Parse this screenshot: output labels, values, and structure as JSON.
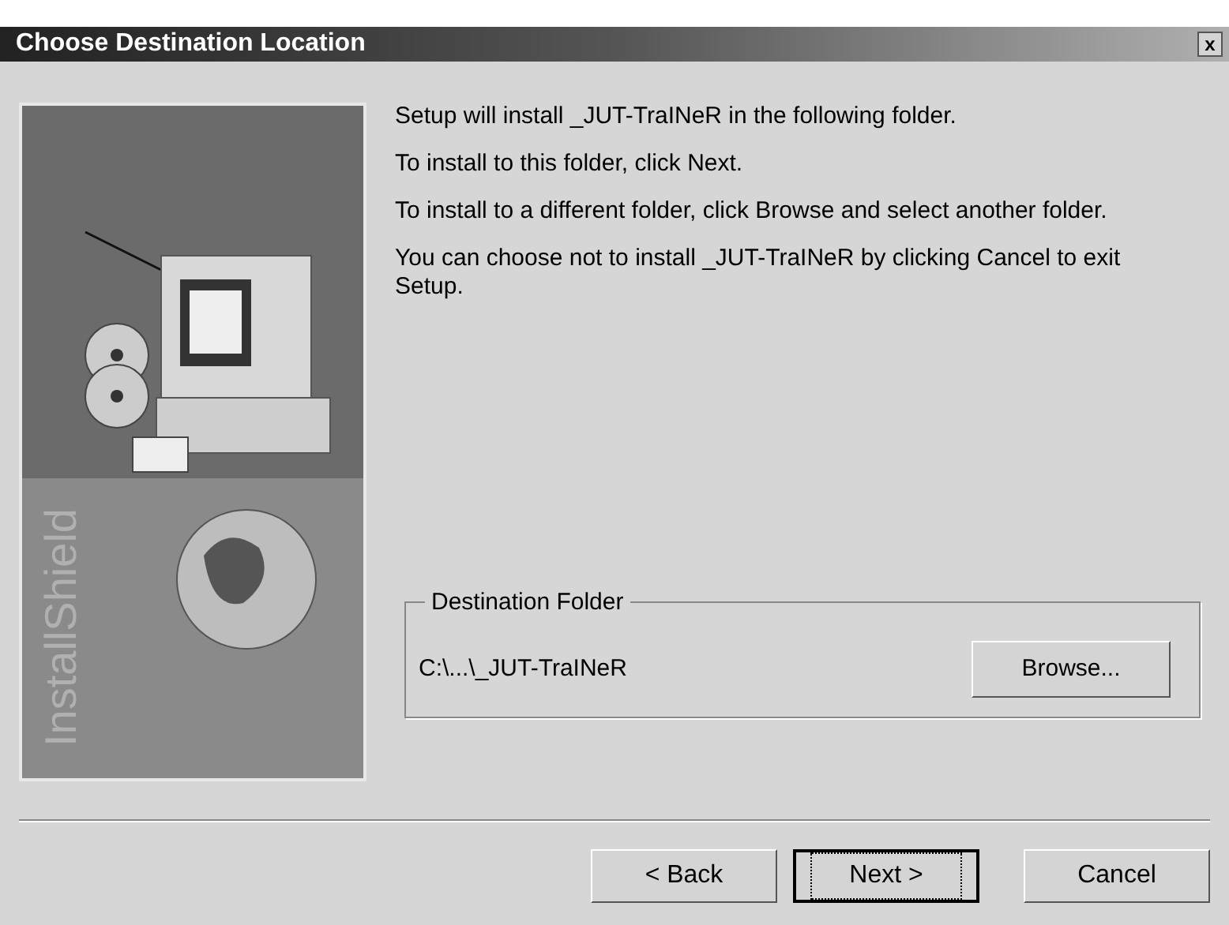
{
  "window": {
    "title": "Choose Destination Location",
    "close": "x"
  },
  "banner": {
    "logo_text": "InstallShield"
  },
  "paragraphs": [
    "Setup will install _JUT-TraINeR in the following folder.",
    "To install to this folder, click Next.",
    "To install to a different folder, click Browse and select another folder.",
    "You can choose not to install _JUT-TraINeR by clicking Cancel to exit Setup."
  ],
  "destination": {
    "legend": "Destination Folder",
    "path": "C:\\...\\_JUT-TraINeR",
    "button": "Browse..."
  },
  "buttons": [
    {
      "label": "< Back",
      "default": false
    },
    {
      "label": "Next >",
      "default": true
    },
    {
      "label": "Cancel",
      "default": false
    }
  ]
}
